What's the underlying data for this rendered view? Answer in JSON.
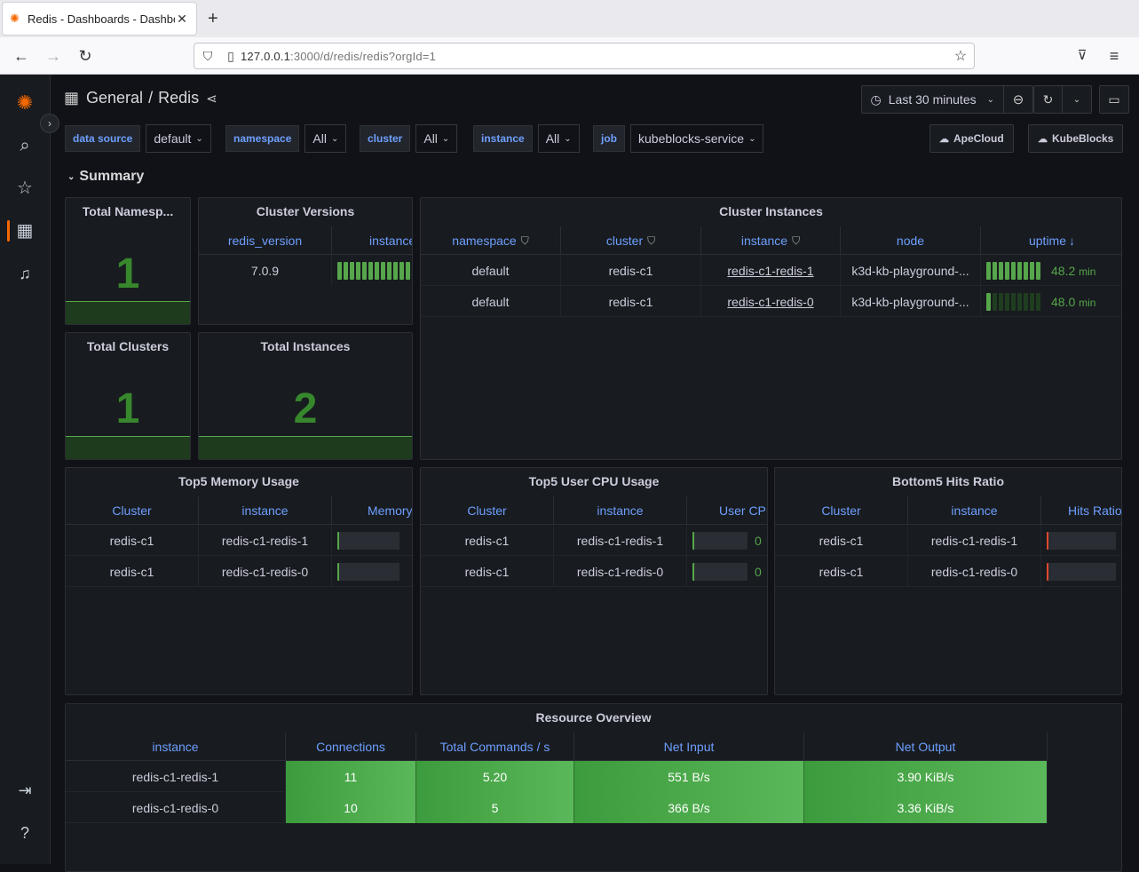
{
  "browser": {
    "tab_title": "Redis - Dashboards - Dashbo",
    "url_host": "127.0.0.1",
    "url_rest": ":3000/d/redis/redis?orgId=1"
  },
  "topnav": {
    "folder": "General",
    "separator": "/",
    "title": "Redis",
    "time_range": "Last 30 minutes"
  },
  "variables": [
    {
      "label": "data source",
      "value": "default"
    },
    {
      "label": "namespace",
      "value": "All"
    },
    {
      "label": "cluster",
      "value": "All"
    },
    {
      "label": "instance",
      "value": "All"
    },
    {
      "label": "job",
      "value": "kubeblocks-service"
    }
  ],
  "links": [
    "ApeCloud",
    "KubeBlocks"
  ],
  "row": {
    "title": "Summary"
  },
  "stats": {
    "namespaces": {
      "title": "Total Namesp...",
      "value": "1"
    },
    "clusters": {
      "title": "Total Clusters",
      "value": "1"
    },
    "instances": {
      "title": "Total Instances",
      "value": "2"
    }
  },
  "cluster_versions": {
    "title": "Cluster Versions",
    "headers": [
      "redis_version",
      "instance"
    ],
    "rows": [
      {
        "version": "7.0.9",
        "instance_fill": 1.0
      }
    ]
  },
  "cluster_instances": {
    "title": "Cluster Instances",
    "headers": [
      "namespace",
      "cluster",
      "instance",
      "node",
      "uptime"
    ],
    "rows": [
      {
        "namespace": "default",
        "cluster": "redis-c1",
        "instance": "redis-c1-redis-1",
        "node": "k3d-kb-playground-...",
        "uptime": "48.2",
        "unit": "min",
        "fill": 1.0
      },
      {
        "namespace": "default",
        "cluster": "redis-c1",
        "instance": "redis-c1-redis-0",
        "node": "k3d-kb-playground-...",
        "uptime": "48.0",
        "unit": "min",
        "fill": 0.1
      }
    ]
  },
  "memory": {
    "title": "Top5 Memory Usage",
    "headers": [
      "Cluster",
      "instance",
      "Memory"
    ],
    "rows": [
      {
        "cluster": "redis-c1",
        "instance": "redis-c1-redis-1"
      },
      {
        "cluster": "redis-c1",
        "instance": "redis-c1-redis-0"
      }
    ]
  },
  "cpu": {
    "title": "Top5 User CPU Usage",
    "headers": [
      "Cluster",
      "instance",
      "User CPU"
    ],
    "rows": [
      {
        "cluster": "redis-c1",
        "instance": "redis-c1-redis-1",
        "value": "0"
      },
      {
        "cluster": "redis-c1",
        "instance": "redis-c1-redis-0",
        "value": "0"
      }
    ]
  },
  "hits": {
    "title": "Bottom5 Hits Ratio",
    "headers": [
      "Cluster",
      "instance",
      "Hits Ratio"
    ],
    "rows": [
      {
        "cluster": "redis-c1",
        "instance": "redis-c1-redis-1"
      },
      {
        "cluster": "redis-c1",
        "instance": "redis-c1-redis-0"
      }
    ]
  },
  "resource": {
    "title": "Resource Overview",
    "headers": [
      "instance",
      "Connections",
      "Total Commands / s",
      "Net Input",
      "Net Output"
    ],
    "rows": [
      {
        "instance": "redis-c1-redis-1",
        "connections": "11",
        "commands": "5.20",
        "net_in": "551 B/s",
        "net_out": "3.90 KiB/s"
      },
      {
        "instance": "redis-c1-redis-0",
        "connections": "10",
        "commands": "5",
        "net_in": "366 B/s",
        "net_out": "3.36 KiB/s"
      }
    ]
  },
  "colors": {
    "accent": "#f46800",
    "link_blue": "#6e9fff",
    "stat_green": "#37872d",
    "gauge_green": "#56a64b",
    "gauge_red": "#e0482d",
    "background": "#111217",
    "panel": "#181b1f"
  },
  "icons": [
    "grafana-logo-icon",
    "search-icon",
    "star-icon",
    "dashboards-icon",
    "bell-icon",
    "sign-in-icon",
    "help-icon",
    "clock-icon",
    "zoom-out-icon",
    "refresh-icon",
    "tv-icon",
    "share-icon",
    "filter-icon",
    "cloud-icon"
  ]
}
